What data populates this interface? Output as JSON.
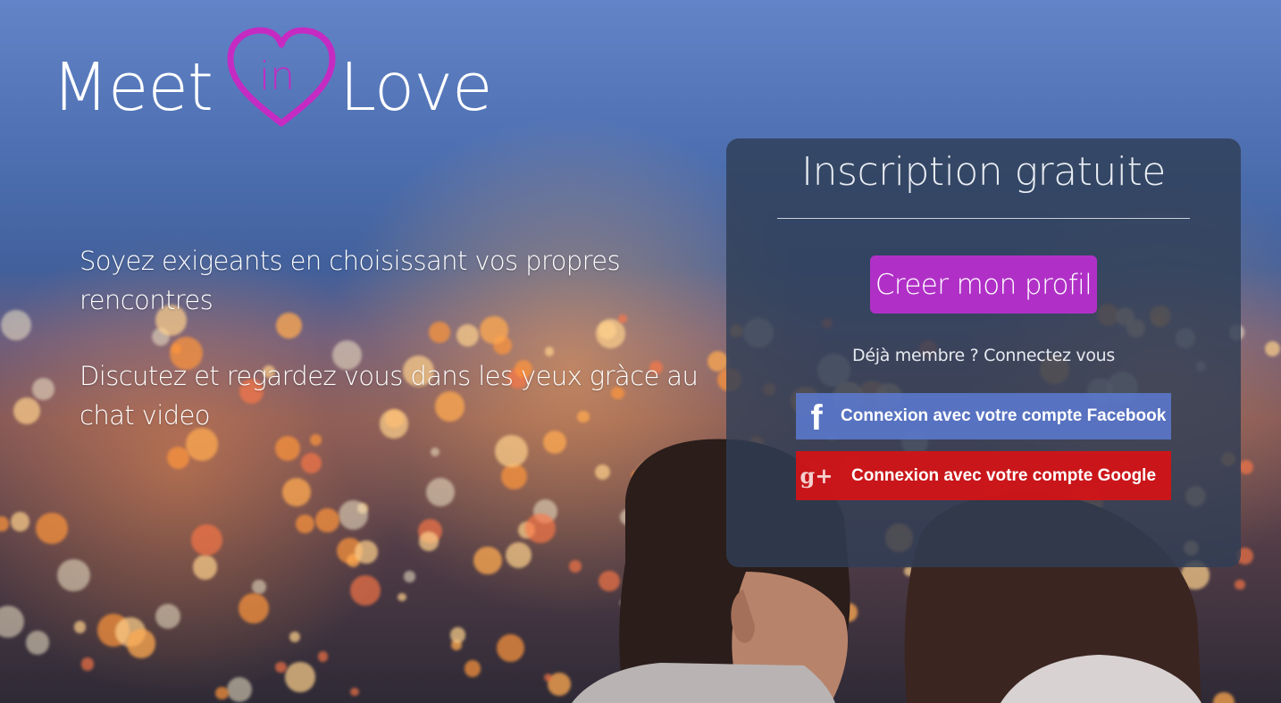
{
  "logo": {
    "word_left": "Meet",
    "word_center": "in",
    "word_right": "Love",
    "heart_color": "#c52bc2"
  },
  "hero": {
    "tagline_1": "Soyez exigeants en choisissant vos propres rencontres",
    "tagline_2": "Discutez et regardez vous dans les yeux gràce au chat video"
  },
  "signup": {
    "title": "Inscription gratuite",
    "create_profile_label": "Creer mon profil",
    "member_link": "Déjà membre ? Connectez vous",
    "facebook_label": "Connexion avec votre compte Facebook",
    "facebook_icon": "f",
    "google_label": "Connexion avec votre compte Google",
    "google_icon": "g+",
    "colors": {
      "create_button": "#b030c7",
      "facebook": "#5c7ad2",
      "google": "#d61216"
    }
  }
}
